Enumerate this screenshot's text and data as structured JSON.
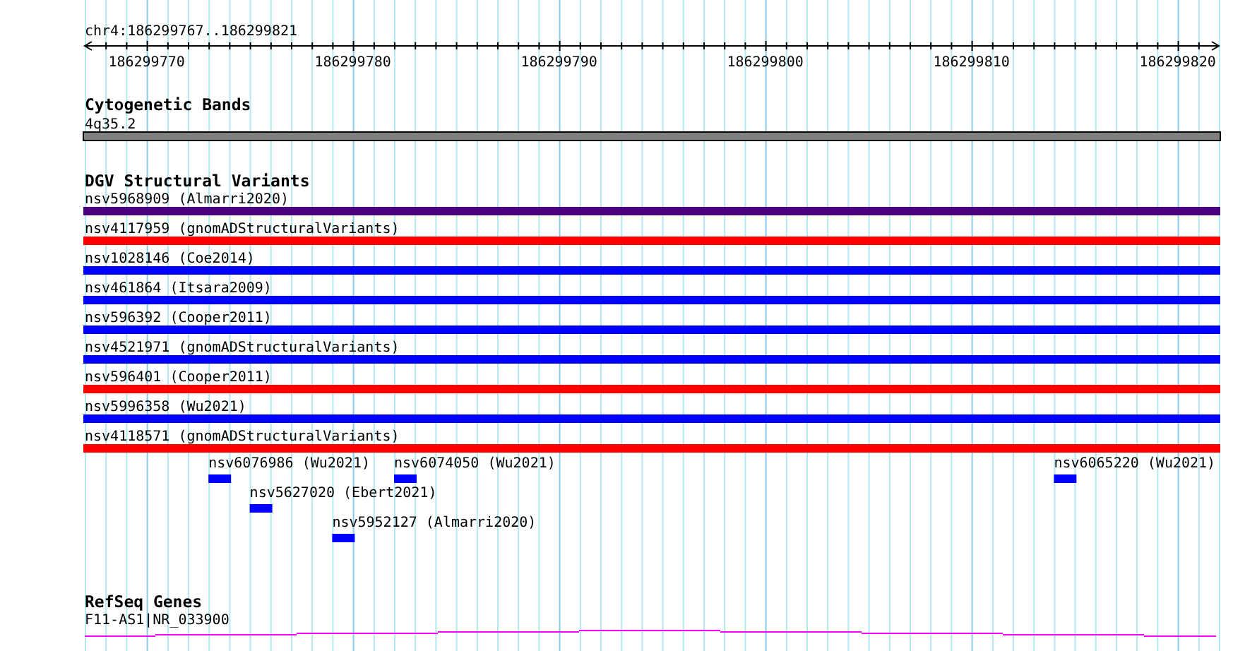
{
  "region": "chr4:186299767..186299821",
  "ruler": {
    "ticks": [
      "186299770",
      "186299780",
      "186299790",
      "186299800",
      "186299810",
      "186299820"
    ]
  },
  "cytogenetic_bands": {
    "title": "Cytogenetic Bands",
    "bands": [
      {
        "label": "4q35.2"
      }
    ]
  },
  "dgv_structural_variants": {
    "title": "DGV Structural Variants",
    "variants": [
      {
        "label": "nsv5968909 (Almarri2020)",
        "color": "#4b0082"
      },
      {
        "label": "nsv4117959 (gnomADStructuralVariants)",
        "color": "#ff0000"
      },
      {
        "label": "nsv1028146 (Coe2014)",
        "color": "#0000ff"
      },
      {
        "label": "nsv461864 (Itsara2009)",
        "color": "#0000ff"
      },
      {
        "label": "nsv596392 (Cooper2011)",
        "color": "#0000ff"
      },
      {
        "label": "nsv4521971 (gnomADStructuralVariants)",
        "color": "#0000ff"
      },
      {
        "label": "nsv596401 (Cooper2011)",
        "color": "#ff0000"
      },
      {
        "label": "nsv5996358 (Wu2021)",
        "color": "#0000ff"
      },
      {
        "label": "nsv4118571 (gnomADStructuralVariants)",
        "color": "#ff0000"
      }
    ],
    "short_variants": [
      {
        "label": "nsv6076986 (Wu2021)",
        "color": "#0000ff"
      },
      {
        "label": "nsv6074050 (Wu2021)",
        "color": "#0000ff"
      },
      {
        "label": "nsv6065220 (Wu2021)",
        "color": "#0000ff"
      },
      {
        "label": "nsv5627020 (Ebert2021)",
        "color": "#0000ff"
      },
      {
        "label": "nsv5952127 (Almarri2020)",
        "color": "#0000ff"
      }
    ]
  },
  "refseq_genes": {
    "title": "RefSeq Genes",
    "genes": [
      {
        "label": "F11-AS1|NR_033900"
      }
    ]
  }
}
